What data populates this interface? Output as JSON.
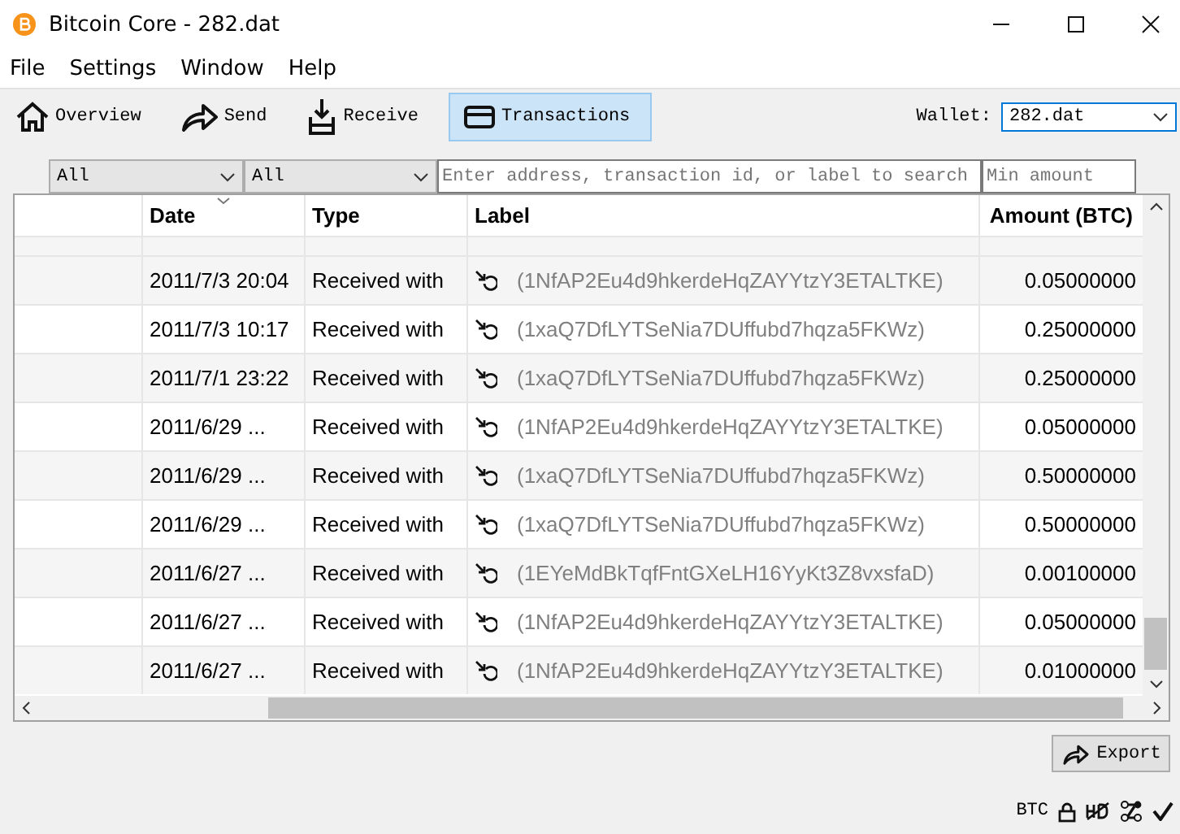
{
  "window": {
    "title": "Bitcoin Core - 282.dat"
  },
  "menu": [
    "File",
    "Settings",
    "Window",
    "Help"
  ],
  "toolbar": [
    {
      "label": "Overview",
      "selected": false
    },
    {
      "label": "Send",
      "selected": false
    },
    {
      "label": "Receive",
      "selected": false
    },
    {
      "label": "Transactions",
      "selected": true
    }
  ],
  "wallet": {
    "label": "Wallet:",
    "value": "282.dat"
  },
  "filters": {
    "date": "All",
    "type": "All",
    "search_placeholder": "Enter address, transaction id, or label to search",
    "amount_placeholder": "Min amount"
  },
  "table": {
    "columns": [
      "Date",
      "Type",
      "Label",
      "Amount (BTC)"
    ],
    "rows": [
      {
        "date": "2011/7/3 20:04",
        "type": "Received with",
        "label": "(1NfAP2Eu4d9hkerdeHqZAYYtzY3ETALTKE)",
        "amount": "0.05000000"
      },
      {
        "date": "2011/7/3 10:17",
        "type": "Received with",
        "label": "(1xaQ7DfLYTSeNia7DUffubd7hqza5FKWz)",
        "amount": "0.25000000"
      },
      {
        "date": "2011/7/1 23:22",
        "type": "Received with",
        "label": "(1xaQ7DfLYTSeNia7DUffubd7hqza5FKWz)",
        "amount": "0.25000000"
      },
      {
        "date": "2011/6/29 ...",
        "type": "Received with",
        "label": "(1NfAP2Eu4d9hkerdeHqZAYYtzY3ETALTKE)",
        "amount": "0.05000000"
      },
      {
        "date": "2011/6/29 ...",
        "type": "Received with",
        "label": "(1xaQ7DfLYTSeNia7DUffubd7hqza5FKWz)",
        "amount": "0.50000000"
      },
      {
        "date": "2011/6/29 ...",
        "type": "Received with",
        "label": "(1xaQ7DfLYTSeNia7DUffubd7hqza5FKWz)",
        "amount": "0.50000000"
      },
      {
        "date": "2011/6/27 ...",
        "type": "Received with",
        "label": "(1EYeMdBkTqfFntGXeLH16YyKt3Z8vxsfaD)",
        "amount": "0.00100000"
      },
      {
        "date": "2011/6/27 ...",
        "type": "Received with",
        "label": "(1NfAP2Eu4d9hkerdeHqZAYYtzY3ETALTKE)",
        "amount": "0.05000000"
      },
      {
        "date": "2011/6/27 ...",
        "type": "Received with",
        "label": "(1NfAP2Eu4d9hkerdeHqZAYYtzY3ETALTKE)",
        "amount": "0.01000000"
      }
    ]
  },
  "export_button": "Export",
  "status_bar": {
    "unit": "BTC"
  }
}
